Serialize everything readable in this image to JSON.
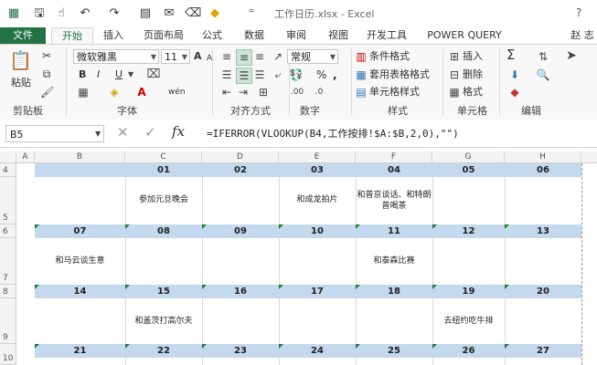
{
  "window": {
    "title": "工作日历.xlsx - Excel",
    "user": "赵 志"
  },
  "quick_access": {
    "icons": [
      "excel-icon",
      "save-icon",
      "touch-mode-icon",
      "undo-icon",
      "redo-icon",
      "form-icon",
      "email-icon",
      "eraser-icon",
      "fill-color-icon",
      "customize-qat-icon"
    ]
  },
  "tabs": [
    "文件",
    "开始",
    "插入",
    "页面布局",
    "公式",
    "数据",
    "审阅",
    "视图",
    "开发工具",
    "POWER QUERY"
  ],
  "ribbon": {
    "clipboard": {
      "label": "剪贴板",
      "paste": "粘贴"
    },
    "font": {
      "label": "字体",
      "name": "微软雅黑",
      "size": "11",
      "bold": "B",
      "italic": "I",
      "underline": "U",
      "grow": "A",
      "shrink": "A",
      "wen": "wén"
    },
    "alignment": {
      "label": "对齐方式"
    },
    "number": {
      "label": "数字",
      "format": "常规",
      "percent": "%",
      "comma": ","
    },
    "styles": {
      "label": "样式",
      "cond": "条件格式",
      "table": "套用表格格式",
      "cell": "单元格样式"
    },
    "cells": {
      "label": "单元格",
      "insert": "插入",
      "delete": "删除",
      "format": "格式"
    },
    "editing": {
      "label": "编辑",
      "sum": "Σ"
    }
  },
  "formula_bar": {
    "name_box": "B5",
    "cancel": "✕",
    "enter": "✓",
    "fx": "fx",
    "formula": "=IFERROR(VLOOKUP(B4,工作按排!$A:$B,2,0),\"\")"
  },
  "columns": [
    "A",
    "B",
    "C",
    "D",
    "E",
    "F",
    "G",
    "H"
  ],
  "rows": [
    {
      "num_row": "4",
      "event_row": "5",
      "days": [
        "",
        "01",
        "02",
        "03",
        "04",
        "05",
        "06"
      ],
      "events": [
        "",
        "参加元旦晚会",
        "",
        "和成龙拍片",
        "和普京谈话、和特朗普喝茶",
        "",
        ""
      ]
    },
    {
      "num_row": "6",
      "event_row": "7",
      "days": [
        "07",
        "08",
        "09",
        "10",
        "11",
        "12",
        "13"
      ],
      "events": [
        "和马云谈生意",
        "",
        "",
        "",
        "和泰森比赛",
        "",
        ""
      ]
    },
    {
      "num_row": "8",
      "event_row": "9",
      "days": [
        "14",
        "15",
        "16",
        "17",
        "18",
        "19",
        "20"
      ],
      "events": [
        "",
        "和盖茨打高尔夫",
        "",
        "",
        "",
        "去纽约吃牛排",
        ""
      ]
    },
    {
      "num_row": "10",
      "event_row": "",
      "days": [
        "21",
        "22",
        "23",
        "24",
        "25",
        "26",
        "27"
      ],
      "events": [
        "",
        "",
        "",
        "",
        "",
        "",
        ""
      ]
    }
  ],
  "colors": {
    "accent": "#217346",
    "day_bar": "#c4d8ee"
  }
}
